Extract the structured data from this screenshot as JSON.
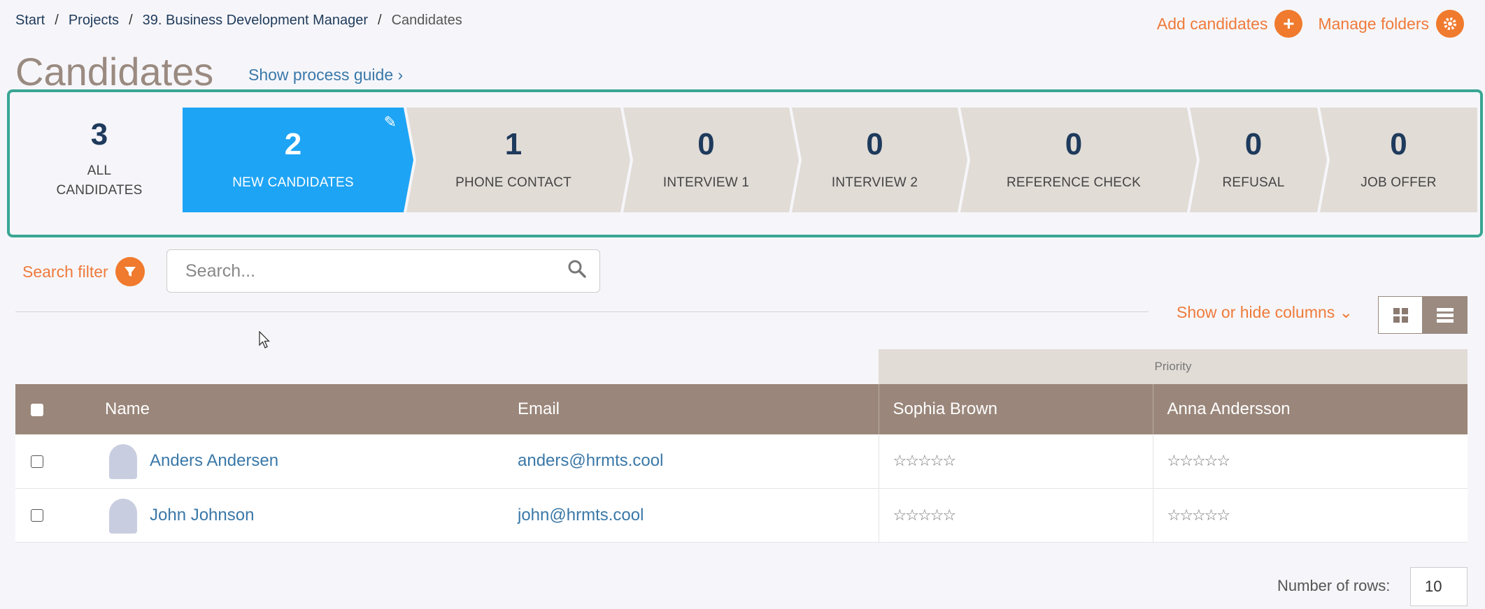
{
  "breadcrumb": {
    "items": [
      "Start",
      "Projects",
      "39. Business Development Manager"
    ],
    "current": "Candidates",
    "separator": "/"
  },
  "actions": {
    "add_candidates": "Add candidates",
    "manage_folders": "Manage folders"
  },
  "page": {
    "title": "Candidates",
    "guide_link": "Show process guide ›"
  },
  "pipeline": {
    "all": {
      "count": "3",
      "label_1": "ALL",
      "label_2": "CANDIDATES"
    },
    "stages": [
      {
        "count": "2",
        "label": "NEW CANDIDATES",
        "active": true
      },
      {
        "count": "1",
        "label": "PHONE CONTACT"
      },
      {
        "count": "0",
        "label": "INTERVIEW 1"
      },
      {
        "count": "0",
        "label": "INTERVIEW 2"
      },
      {
        "count": "0",
        "label": "REFERENCE CHECK"
      },
      {
        "count": "0",
        "label": "REFUSAL"
      },
      {
        "count": "0",
        "label": "JOB OFFER"
      }
    ],
    "accent_color": "#3aa693",
    "active_color": "#1ea4f5"
  },
  "filter": {
    "label": "Search filter",
    "search_placeholder": "Search..."
  },
  "columns_toggle": {
    "label": "Show or hide columns ⌄"
  },
  "table": {
    "priority_label": "Priority",
    "headers": {
      "name": "Name",
      "email": "Email",
      "rater_1": "Sophia Brown",
      "rater_2": "Anna Andersson"
    },
    "rows": [
      {
        "name": "Anders Andersen",
        "email": "anders@hrmts.cool",
        "rating_1": "☆☆☆☆☆",
        "rating_2": "☆☆☆☆☆"
      },
      {
        "name": "John Johnson",
        "email": "john@hrmts.cool",
        "rating_1": "☆☆☆☆☆",
        "rating_2": "☆☆☆☆☆"
      }
    ]
  },
  "pagination": {
    "rows_label": "Number of rows:",
    "rows_value": "10"
  }
}
